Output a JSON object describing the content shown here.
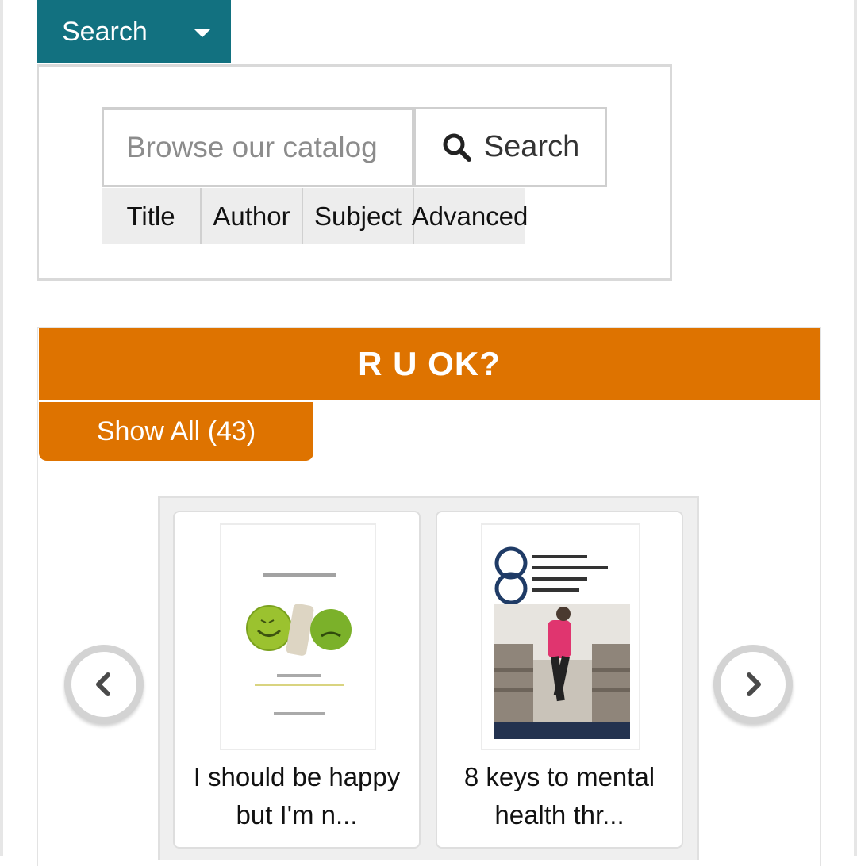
{
  "search_tab": {
    "label": "Search"
  },
  "search": {
    "placeholder": "Browse our catalog",
    "button_label": "Search",
    "types": [
      "Title",
      "Author",
      "Subject",
      "Advanced"
    ]
  },
  "widget": {
    "title": "R U OK?",
    "show_all_label": "Show All",
    "show_all_count": "(43)",
    "items": [
      {
        "title": "I should be happy but I'm n..."
      },
      {
        "title": "8 keys to mental health thr..."
      }
    ]
  },
  "colors": {
    "teal": "#127180",
    "orange": "#de7300"
  },
  "icons": {
    "search": "search-icon",
    "prev": "chevron-left-icon",
    "next": "chevron-right-icon"
  }
}
